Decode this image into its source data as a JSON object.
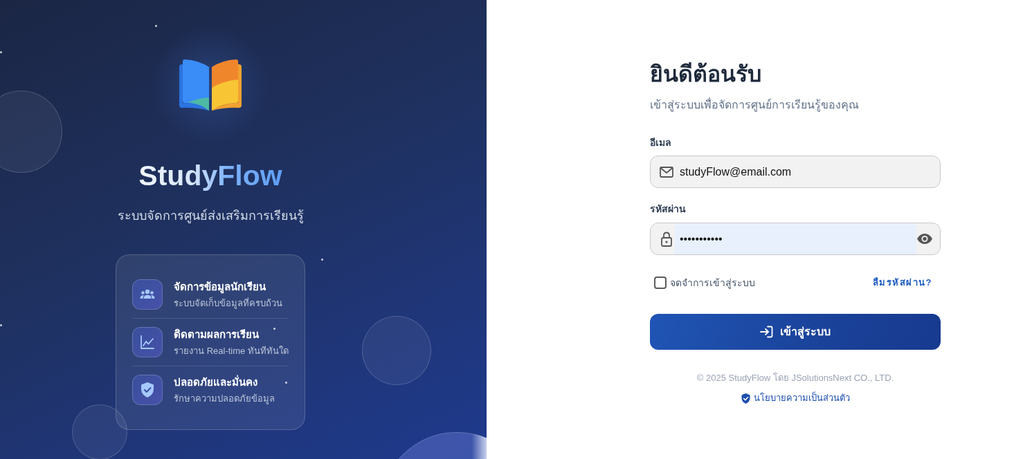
{
  "brand_panel": {
    "name": "StudyFlow",
    "tagline": "ระบบจัดการศูนย์ส่งเสริมการเรียนรู้",
    "features": [
      {
        "title": "จัดการข้อมูลนักเรียน",
        "description": "ระบบจัดเก็บข้อมูลที่ครบถ้วน"
      },
      {
        "title": "ติดตามผลการเรียน",
        "description": "รายงาน Real-time ทันทีทันใด"
      },
      {
        "title": "ปลอดภัยและมั่นคง",
        "description": "รักษาความปลอดภัยข้อมูล"
      }
    ]
  },
  "login_form": {
    "title": "ยินดีต้อนรับ",
    "subtitle": "เข้าสู่ระบบเพื่อจัดการศูนย์การเรียนรู้ของคุณ",
    "fields": [
      {
        "kind": "email",
        "label": "อีเมล",
        "value": "studyFlow@email.com",
        "autofilled": false
      },
      {
        "kind": "password",
        "label": "รหัสผ่าน",
        "value": "•••••••••••",
        "autofilled": true
      }
    ],
    "remember": {
      "label": "จดจำการเข้าสู่ระบบ",
      "checked": false
    },
    "forgot_link": "ลืมรหัสผ่าน?",
    "submit_button": "เข้าสู่ระบบ",
    "copyright": "© 2025 StudyFlow โดย JSolutionsNext CO., LTD.",
    "privacy_link": "นโยบายความเป็นส่วนตัว"
  }
}
